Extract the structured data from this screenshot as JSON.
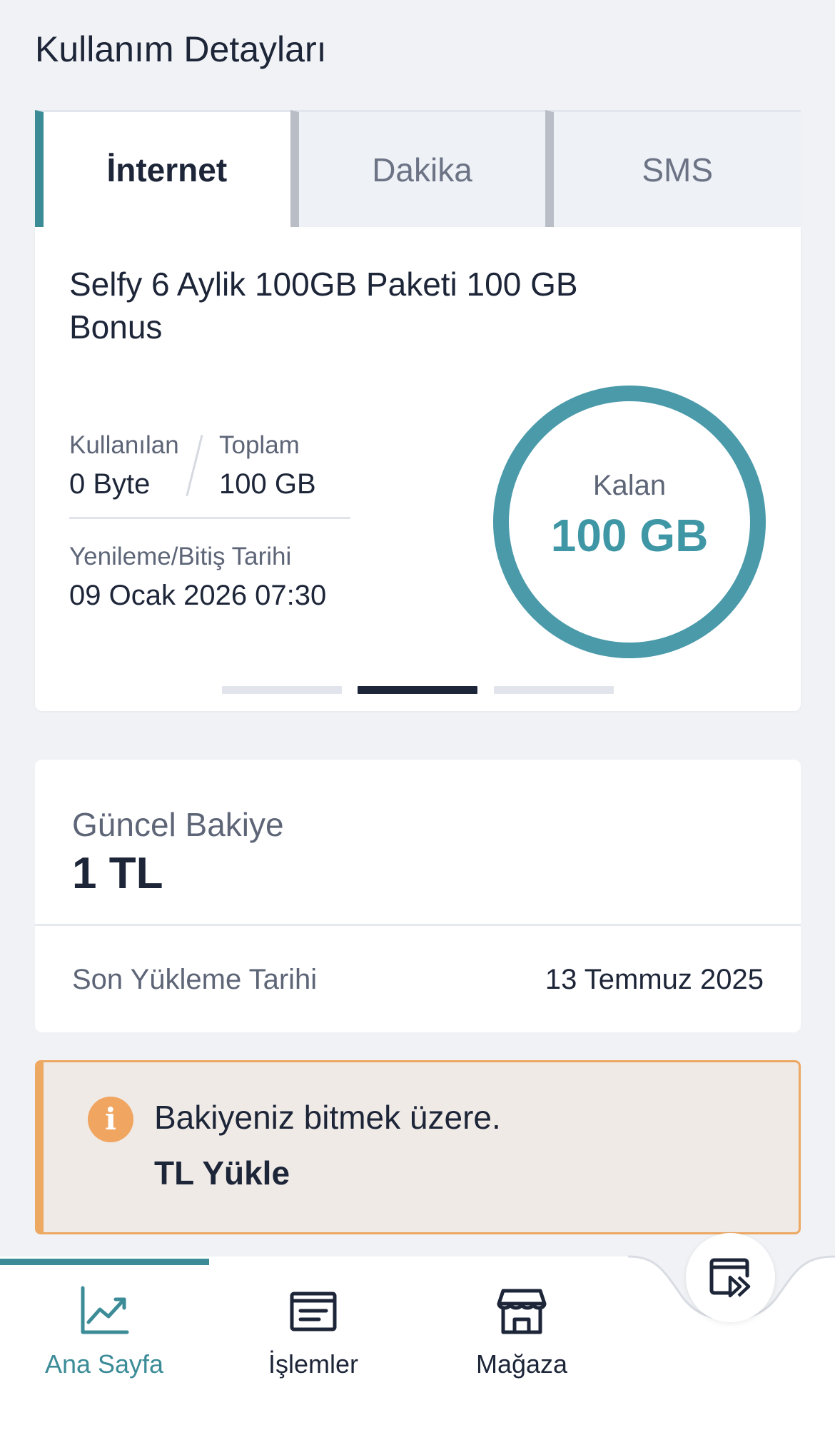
{
  "page": {
    "title": "Kullanım Detayları"
  },
  "tabs": [
    {
      "label": "İnternet",
      "active": true
    },
    {
      "label": "Dakika",
      "active": false
    },
    {
      "label": "SMS",
      "active": false
    }
  ],
  "usage": {
    "package_name": "Selfy 6 Aylik 100GB Paketi 100 GB Bonus",
    "used_label": "Kullanılan",
    "used_value": "0 Byte",
    "total_label": "Toplam",
    "total_value": "100 GB",
    "renew_label": "Yenileme/Bitiş Tarihi",
    "renew_value": "09 Ocak 2026 07:30",
    "remaining_label": "Kalan",
    "remaining_value": "100 GB",
    "remaining_fraction": 1.0,
    "carousel": {
      "count": 3,
      "active_index": 1
    }
  },
  "balance": {
    "label": "Güncel Bakiye",
    "value": "1 TL",
    "last_topup_label": "Son Yükleme Tarihi",
    "last_topup_value": "13 Temmuz 2025"
  },
  "warning": {
    "icon": "info-icon",
    "message": "Bakiyeniz bitmek üzere.",
    "action": "TL Yükle"
  },
  "bottom_nav": {
    "items": [
      {
        "label": "Ana Sayfa",
        "icon": "chart-icon",
        "active": true
      },
      {
        "label": "İşlemler",
        "icon": "list-icon",
        "active": false
      },
      {
        "label": "Mağaza",
        "icon": "store-icon",
        "active": false
      }
    ],
    "fab_icon": "media-forward-icon"
  },
  "colors": {
    "accent": "#3f97a6",
    "accent_dark": "#3c8c98",
    "text": "#1d2538",
    "muted": "#5d6577",
    "warning": "#eda862",
    "warning_bg": "#efeae6"
  }
}
